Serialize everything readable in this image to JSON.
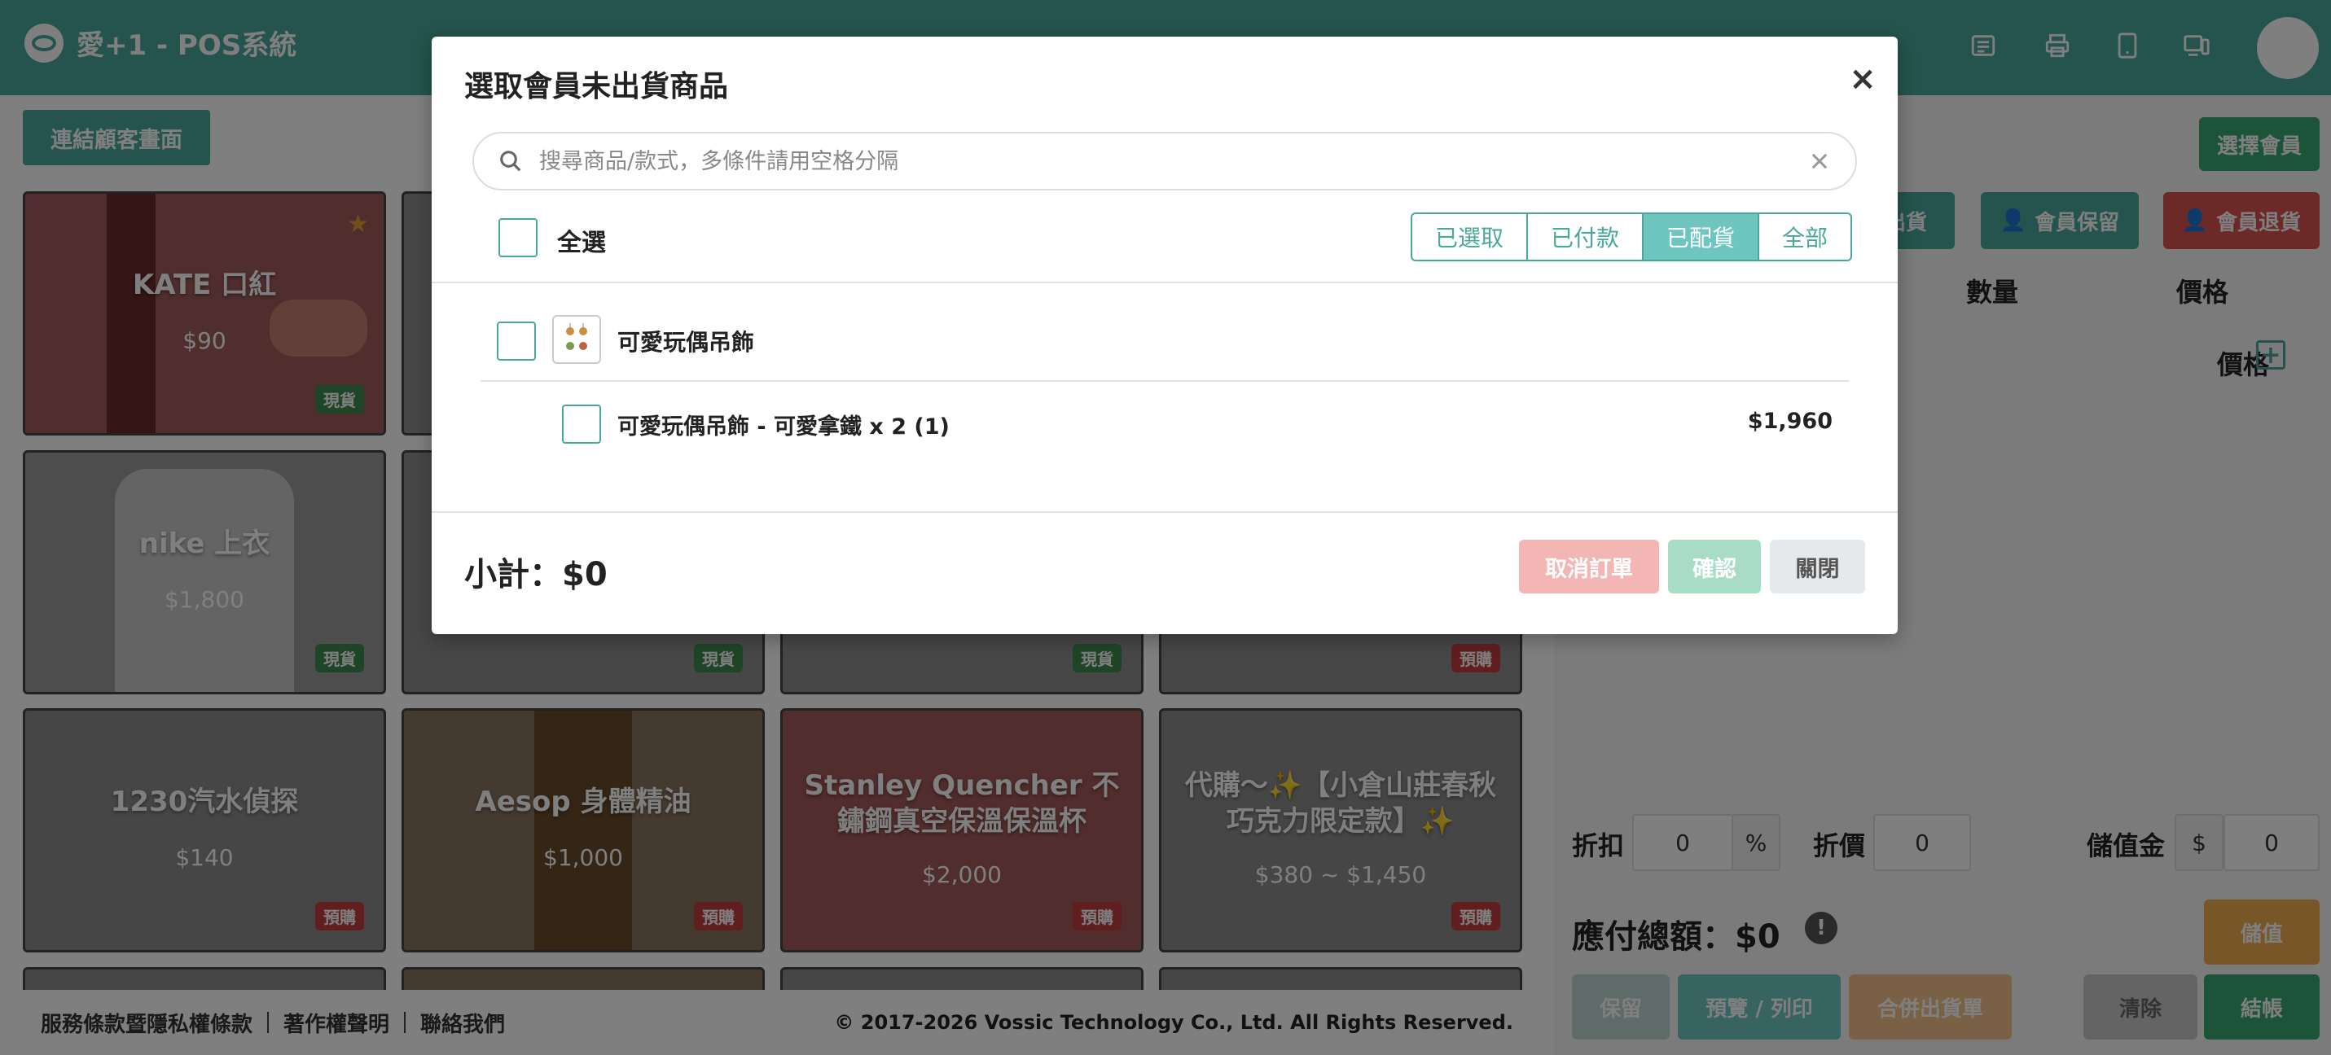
{
  "app": {
    "title": "愛+1 - POS系統"
  },
  "connect_button": "連結顧客畫面",
  "products": [
    {
      "name": "KATE 口紅",
      "price": "$90",
      "badge": "現貨",
      "badge_type": "stock",
      "bg": "#a06060"
    },
    {
      "name": "nike 上衣",
      "price": "$1,800",
      "badge": "現貨",
      "badge_type": "stock",
      "bg": "#9a9a9a"
    },
    {
      "name": "",
      "price": "",
      "badge": "現貨",
      "badge_type": "stock",
      "bg": "#8f8f8f"
    },
    {
      "name": "",
      "price": "",
      "badge": "現貨",
      "badge_type": "stock",
      "bg": "#8f8f8f"
    },
    {
      "name": "",
      "price": "",
      "badge": "預購",
      "badge_type": "pre",
      "bg": "#8f8f8f"
    },
    {
      "name": "1230汽水偵探",
      "price": "$140",
      "badge": "預購",
      "badge_type": "pre",
      "bg": "#8c8c8c"
    },
    {
      "name": "Aesop 身體精油",
      "price": "$1,000",
      "badge": "預購",
      "badge_type": "pre",
      "bg": "#8a7460"
    },
    {
      "name": "Stanley Quencher 不鏽鋼真空保溫保溫杯",
      "price": "$2,000",
      "badge": "預購",
      "badge_type": "pre",
      "bg": "#a35a5a"
    },
    {
      "name": "代購～✨【小倉山莊春秋巧克力限定款】✨",
      "price": "$380 ~ $1,450",
      "badge": "預購",
      "badge_type": "pre",
      "bg": "#8c8c8c"
    }
  ],
  "footer": {
    "links": [
      "服務條款暨隱私權條款",
      "著作權聲明",
      "聯絡我們"
    ],
    "copyright": "© 2017-2026 Vossic Technology Co., Ltd. All Rights Reserved."
  },
  "right_panel": {
    "select_member": "選擇會員",
    "ship_partial": "出貨",
    "member_hold": "會員保留",
    "member_return": "會員退貨",
    "col_qty": "數量",
    "col_price": "價格",
    "row_price": "價格",
    "discount_label": "折扣",
    "discount_value": "0",
    "percent": "%",
    "price_off_label": "折價",
    "price_off_value": "0",
    "stored_label": "儲值金",
    "currency": "$",
    "stored_value": "0",
    "total": "應付總額：$0",
    "topup": "儲值",
    "hold": "保留",
    "preview_print": "預覽 / 列印",
    "merge_ship": "合併出貨單",
    "clear": "清除",
    "checkout": "結帳"
  },
  "modal": {
    "title": "選取會員未出貨商品",
    "close": "×",
    "search_placeholder": "搜尋商品/款式，多條件請用空格分隔",
    "select_all": "全選",
    "filters": [
      "已選取",
      "已付款",
      "已配貨",
      "全部"
    ],
    "active_filter": "已配貨",
    "group_name": "可愛玩偶吊飾",
    "item_label": "可愛玩偶吊飾 - 可愛拿鐵 x 2 (1)",
    "item_price": "$1,960",
    "subtotal": "小計：$0",
    "cancel_order": "取消訂單",
    "confirm": "確認",
    "close_button": "關閉"
  },
  "colors": {
    "brand": "#48a99a",
    "danger": "#d9534f",
    "warning": "#f0ad4e",
    "success": "#38a874"
  }
}
